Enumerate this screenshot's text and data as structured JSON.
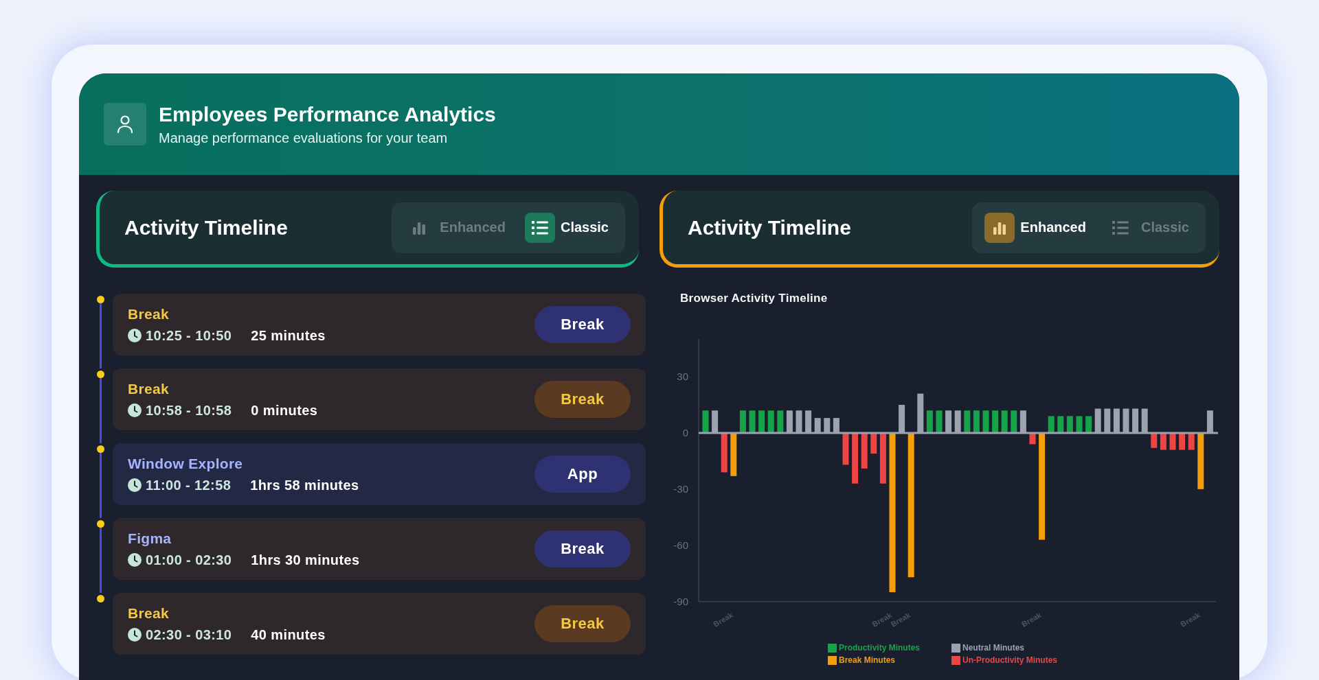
{
  "header": {
    "title": "Employees Performance Analytics",
    "subtitle": "Manage performance evaluations for your team"
  },
  "panels": [
    {
      "title": "Activity Timeline",
      "options": [
        {
          "label": "Enhanced",
          "kind": "enhanced",
          "selected": false
        },
        {
          "label": "Classic",
          "kind": "classic",
          "selected": true
        }
      ]
    },
    {
      "title": "Activity Timeline",
      "options": [
        {
          "label": "Enhanced",
          "kind": "enhanced",
          "selected": true
        },
        {
          "label": "Classic",
          "kind": "classic",
          "selected": false
        }
      ]
    }
  ],
  "timeline": [
    {
      "title": "Break",
      "kind": "break",
      "time": "10:25 - 10:50",
      "duration": "25 minutes",
      "selected": false,
      "badge": {
        "label": "Break",
        "kind": "indigo"
      }
    },
    {
      "title": "Break",
      "kind": "break",
      "time": "10:58 - 10:58",
      "duration": "0 minutes",
      "selected": false,
      "badge": {
        "label": "Break",
        "kind": "amber"
      }
    },
    {
      "title": "Window Explore",
      "kind": "app",
      "time": "11:00 - 12:58",
      "duration": "1hrs 58 minutes",
      "selected": true,
      "badge": {
        "label": "App",
        "kind": "indigo"
      }
    },
    {
      "title": "Figma",
      "kind": "app",
      "time": "01:00 - 02:30",
      "duration": "1hrs 30 minutes",
      "selected": false,
      "badge": {
        "label": "Break",
        "kind": "indigo"
      }
    },
    {
      "title": "Break",
      "kind": "break",
      "time": "02:30 - 03:10",
      "duration": "40 minutes",
      "selected": false,
      "badge": {
        "label": "Break",
        "kind": "amber"
      }
    }
  ],
  "chart": {
    "chart_data": {
      "type": "bar",
      "title": "Browser Activity Timeline",
      "categories": [
        null,
        null,
        null,
        "Break",
        null,
        null,
        null,
        null,
        null,
        null,
        null,
        null,
        null,
        null,
        null,
        null,
        null,
        null,
        null,
        null,
        "Break",
        null,
        "Break",
        null,
        null,
        null,
        null,
        null,
        null,
        null,
        null,
        null,
        null,
        null,
        null,
        null,
        "Break",
        null,
        null,
        null,
        null,
        null,
        null,
        null,
        null,
        null,
        null,
        null,
        null,
        null,
        null,
        null,
        null,
        "Break",
        null
      ],
      "yticks": [
        30,
        0,
        -30,
        -60,
        -90
      ],
      "ylim": [
        -90,
        50
      ],
      "series": [
        {
          "name": "Productivity Minutes",
          "color": "#16a34a",
          "values": [
            12,
            null,
            null,
            null,
            12,
            12,
            12,
            12,
            12,
            null,
            null,
            null,
            null,
            null,
            null,
            null,
            null,
            null,
            null,
            null,
            null,
            null,
            null,
            null,
            12,
            12,
            null,
            null,
            12,
            12,
            12,
            12,
            12,
            12,
            null,
            null,
            null,
            9,
            9,
            9,
            9,
            9,
            null,
            null,
            null,
            null,
            null,
            null,
            null,
            null,
            null,
            null,
            null,
            null,
            null
          ]
        },
        {
          "name": "Neutral Minutes",
          "color": "#9ca3af",
          "values": [
            null,
            12,
            null,
            null,
            null,
            null,
            null,
            null,
            null,
            12,
            12,
            12,
            8,
            8,
            8,
            null,
            null,
            null,
            null,
            null,
            null,
            15,
            null,
            21,
            null,
            null,
            12,
            12,
            null,
            null,
            null,
            null,
            null,
            null,
            12,
            null,
            null,
            null,
            null,
            null,
            null,
            null,
            13,
            13,
            13,
            13,
            13,
            13,
            null,
            null,
            null,
            null,
            null,
            null,
            12
          ]
        },
        {
          "name": "Break Minutes",
          "color": "#f59e0b",
          "values": [
            null,
            null,
            null,
            -23,
            null,
            null,
            null,
            null,
            null,
            null,
            null,
            null,
            null,
            null,
            null,
            null,
            null,
            null,
            null,
            null,
            -85,
            null,
            -77,
            null,
            null,
            null,
            null,
            null,
            null,
            null,
            null,
            null,
            null,
            null,
            null,
            null,
            -57,
            null,
            null,
            null,
            null,
            null,
            null,
            null,
            null,
            null,
            null,
            null,
            null,
            null,
            null,
            null,
            null,
            -30,
            null
          ]
        },
        {
          "name": "Un-Productivity Minutes",
          "color": "#ef4444",
          "values": [
            null,
            null,
            -21,
            null,
            null,
            null,
            null,
            null,
            null,
            null,
            null,
            null,
            null,
            null,
            null,
            -17,
            -27,
            -19,
            -11,
            -27,
            null,
            null,
            null,
            null,
            null,
            null,
            null,
            null,
            null,
            null,
            null,
            null,
            null,
            null,
            null,
            -6,
            null,
            null,
            null,
            null,
            null,
            null,
            null,
            null,
            null,
            null,
            null,
            null,
            -8,
            -9,
            -9,
            -9,
            -9,
            null,
            null
          ]
        }
      ]
    }
  }
}
